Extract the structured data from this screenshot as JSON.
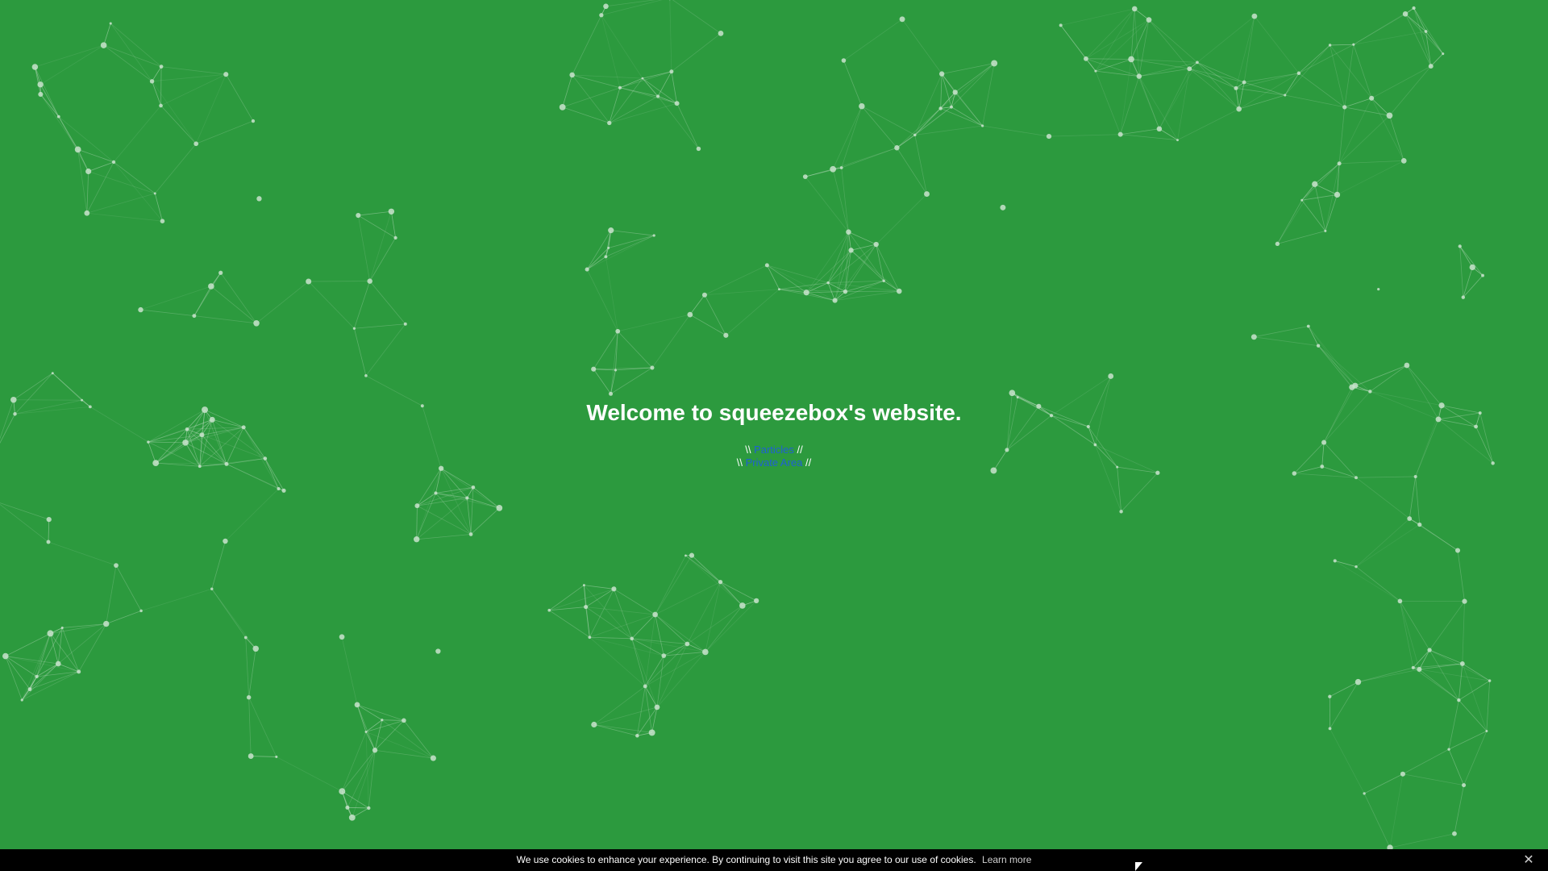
{
  "page": {
    "heading": "Welcome to squeezebox's website.",
    "colors": {
      "background": "#2c9a3e",
      "link": "#1f5fd6",
      "text": "#ffffff",
      "particle": "#c9e3cc"
    }
  },
  "nav": {
    "prefix": "\\\\",
    "suffix": "//",
    "links": [
      {
        "label": "Particles"
      },
      {
        "label": "Private Area"
      }
    ]
  },
  "cookie_banner": {
    "message": "We use cookies to enhance your experience. By continuing to visit this site you agree to our use of cookies.",
    "learn_more": "Learn more",
    "close_icon": "close-icon",
    "close_glyph": "✕"
  }
}
